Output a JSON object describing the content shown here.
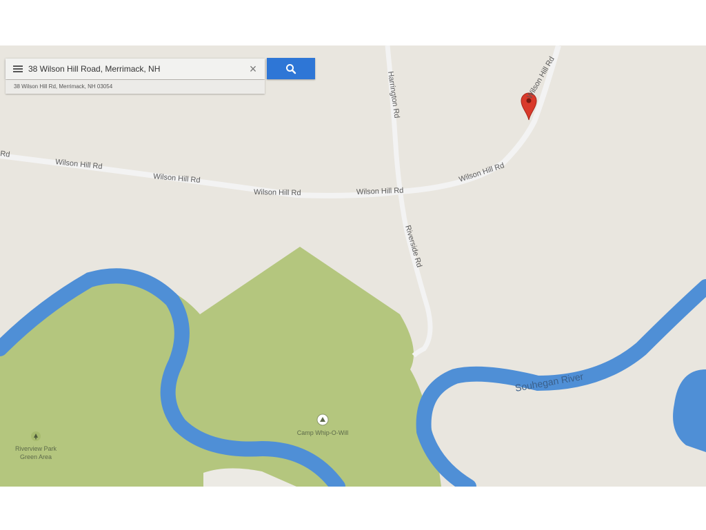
{
  "search": {
    "value": "38 Wilson Hill Road, Merrimack, NH",
    "placeholder": "",
    "suggestion": "38 Wilson Hill Rd, Merrimack, NH 03054"
  },
  "icons": {
    "menu": "menu-icon",
    "clear": "close-icon",
    "search": "search-icon",
    "marker": "map-marker-icon",
    "camp": "campground-icon",
    "park": "park-tree-icon"
  },
  "colors": {
    "land": "#e9e6df",
    "park": "#b4c67e",
    "water": "#4f8fd6",
    "road": "#f3f3f3",
    "search_button": "#2e76d6",
    "marker": "#d93a2b"
  },
  "map": {
    "roads": {
      "wilson_hill_rd_1": "Wilson Hill Rd",
      "wilson_hill_rd_2": "Wilson Hill Rd",
      "wilson_hill_rd_3": "Wilson Hill Rd",
      "wilson_hill_rd_4": "Wilson Hill Rd",
      "wilson_hill_rd_5": "Wilson Hill Rd",
      "wilson_hill_rd_6": "Wilson Hill Rd",
      "partial_rd": "Rd",
      "harrington_rd": "Harrington Rd",
      "riverside_rd": "Riverside Rd"
    },
    "river": "Souhegan River",
    "poi": {
      "camp": "Camp Whip-O-Will",
      "park_line1": "Riverview Park",
      "park_line2": "Green Area"
    }
  }
}
